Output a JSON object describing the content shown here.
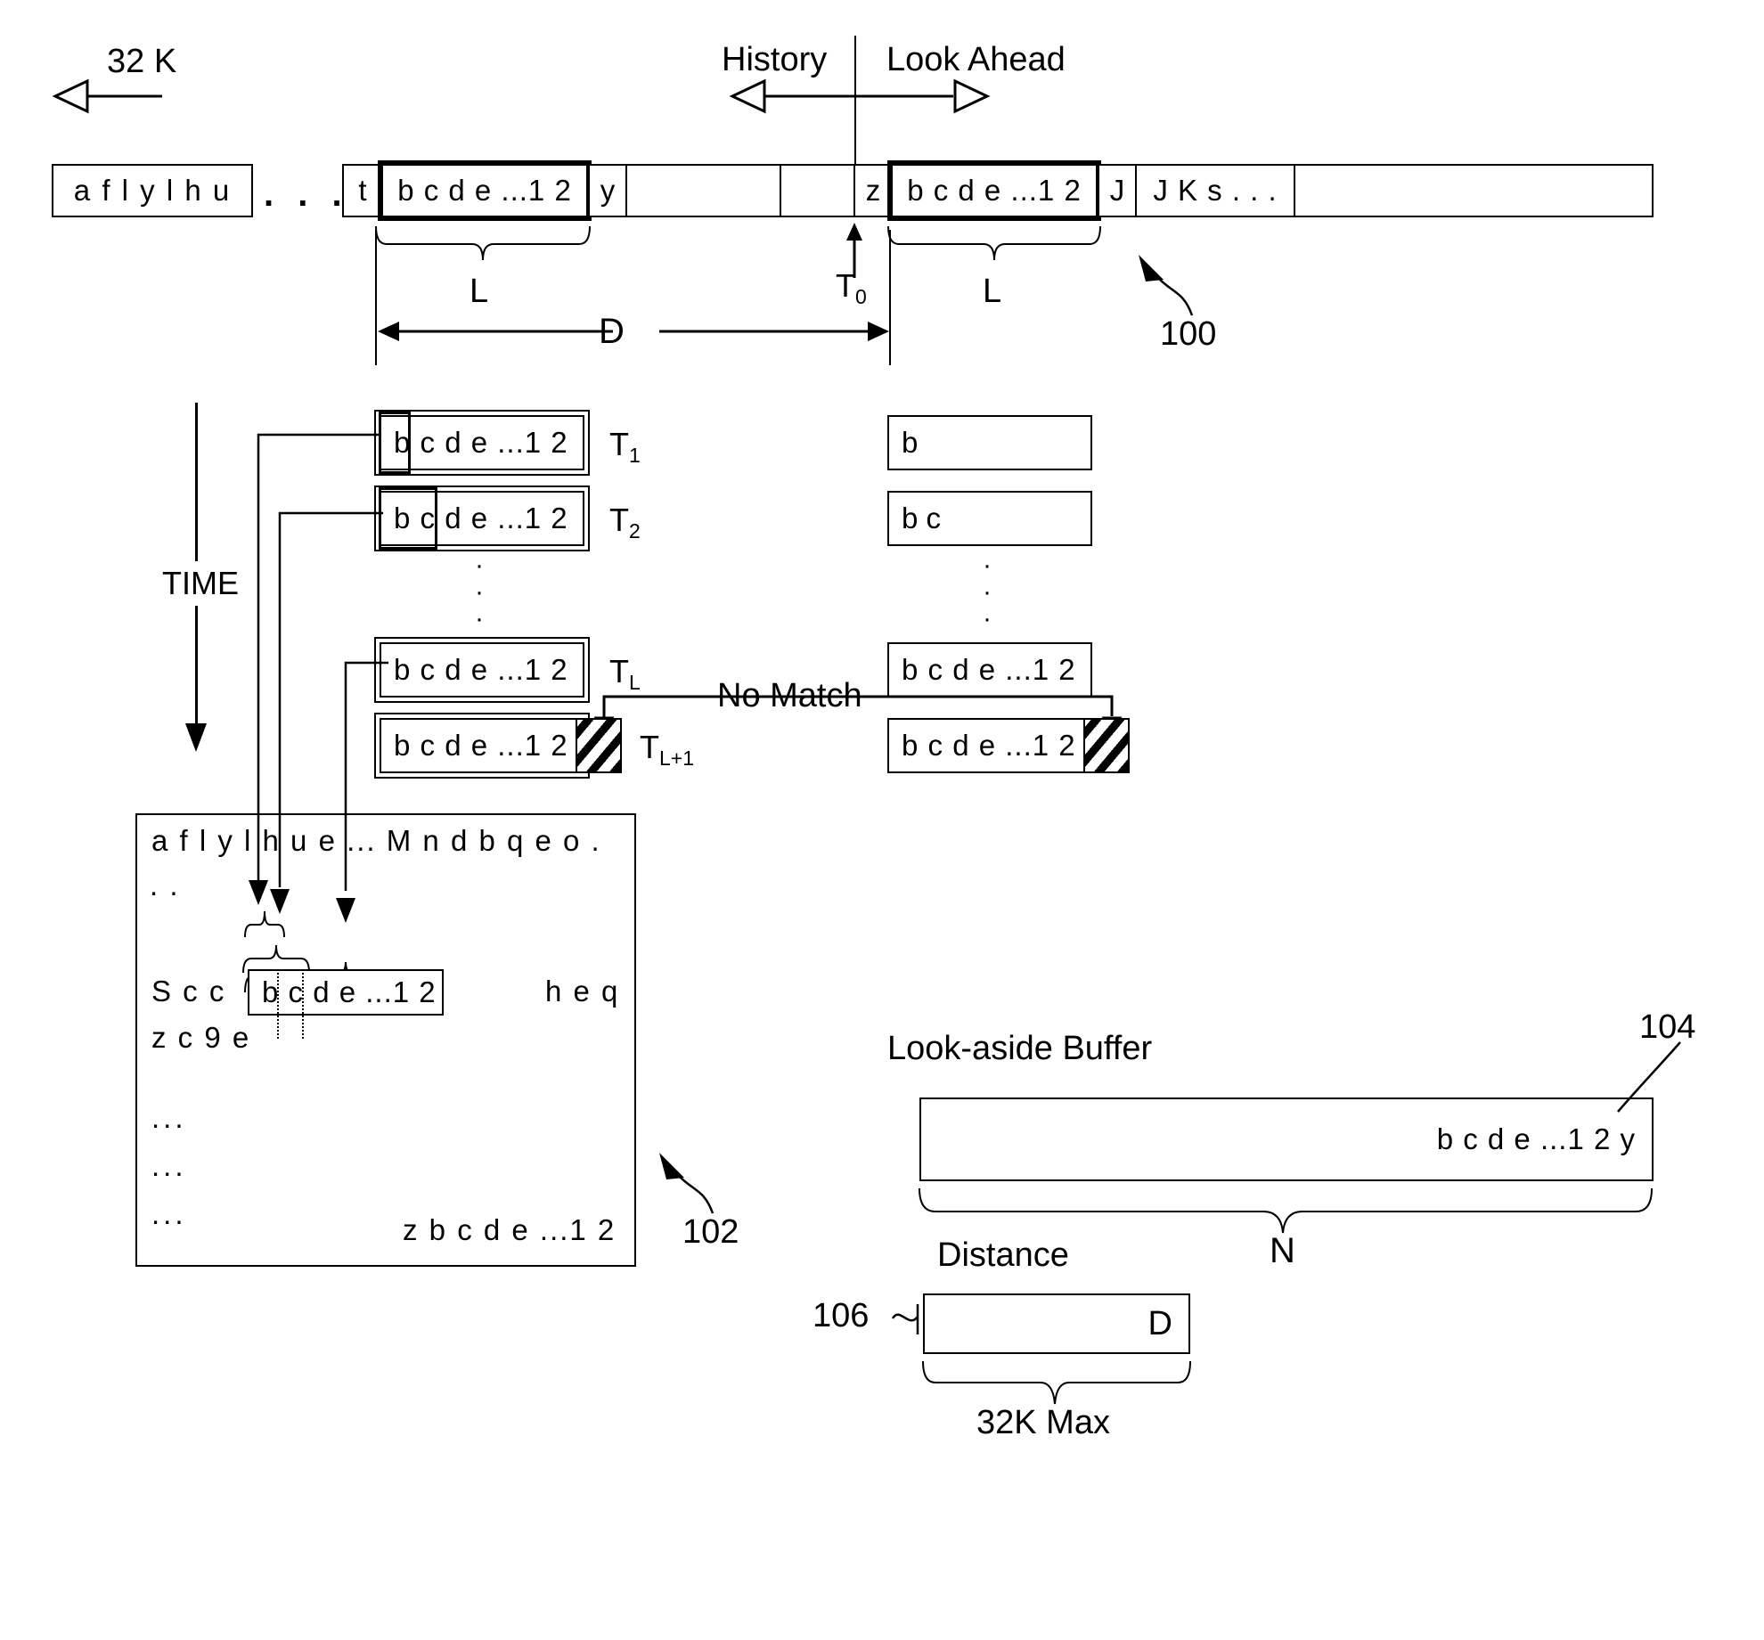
{
  "figure": {
    "top_left_label": "32 K",
    "history_label": "History",
    "lookahead_label": "Look Ahead",
    "t0_label": "T",
    "t0_sub": "0",
    "ref_100": "100",
    "ref_102": "102",
    "ref_104": "104",
    "ref_106": "106",
    "L_left": "L",
    "L_right": "L",
    "D_label": "D",
    "time_label": "TIME",
    "no_match_label": "No Match",
    "lookaside_title": "Look-aside Buffer",
    "N_label": "N",
    "distance_title": "Distance",
    "distance_value": "D",
    "max_label": "32K Max"
  },
  "main_strip": {
    "cells": [
      {
        "text": "a f l y l h u",
        "name": "strip-cell-aflylhu"
      },
      {
        "text": ". . .",
        "name": "strip-ellipsis"
      },
      {
        "text": "t",
        "name": "strip-cell-t"
      },
      {
        "text": "b c d e ...1 2",
        "name": "strip-match-history"
      },
      {
        "text": "y",
        "name": "strip-cell-y"
      },
      {
        "text": "",
        "name": "strip-cell-blank-1"
      },
      {
        "text": "",
        "name": "strip-cell-blank-2"
      },
      {
        "text": "z",
        "name": "strip-cell-z"
      },
      {
        "text": "b c d e ...1 2",
        "name": "strip-match-lookahead"
      },
      {
        "text": "J",
        "name": "strip-cell-j"
      },
      {
        "text": "J K s . . .",
        "name": "strip-cell-jks"
      }
    ]
  },
  "time_rows": [
    {
      "left_text": "b c d e ...1 2",
      "label": "T",
      "sub": "1",
      "right_text": "b"
    },
    {
      "left_text": "b c d e ...1 2",
      "label": "T",
      "sub": "2",
      "right_text": "b c"
    },
    {
      "left_text": "b c d e ...1 2",
      "label": "T",
      "sub": "L",
      "right_text": "b c d e ...1 2"
    },
    {
      "left_text": "b c d e ...1 2",
      "label": "T",
      "sub": "L+1",
      "right_text": "b c d e ...1 2"
    }
  ],
  "history_buffer_102": {
    "line1": "a f l y l h u e ...   M n d b q e o .",
    "line2": ". .",
    "line3_prefix": "S c c",
    "line3_box": "b c d e ...1 2",
    "line3_suffix": "h e q",
    "line4": "z c 9 e",
    "ellipsis1": "...",
    "ellipsis2": "...",
    "ellipsis3": "...",
    "line_last": "z b c d e ...1 2"
  },
  "lookaside_buffer_104": {
    "content": "b c d e ...1 2 y"
  },
  "vertical_dots": "·"
}
